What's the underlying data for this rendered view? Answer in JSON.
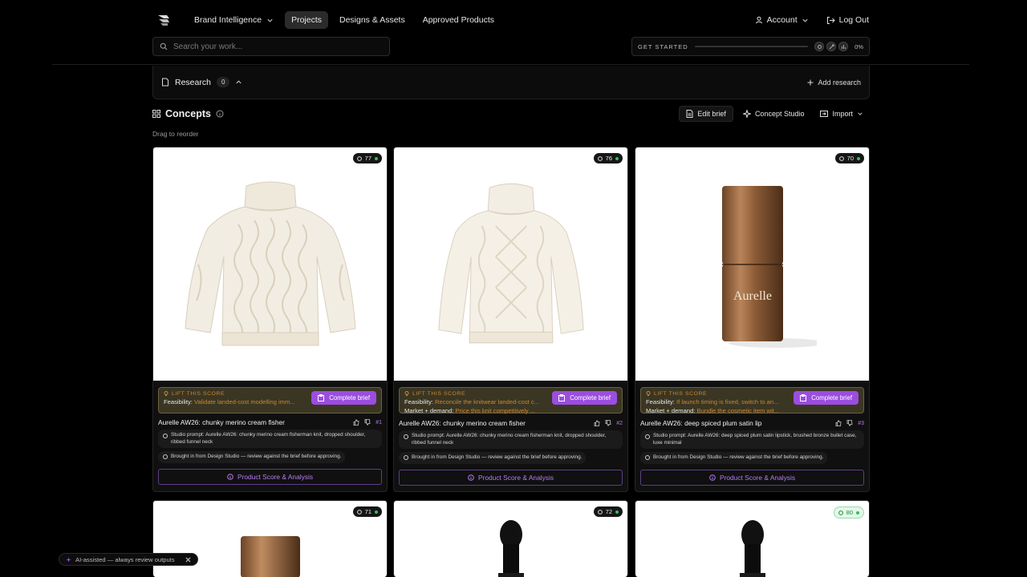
{
  "nav": {
    "items": [
      {
        "label": "Brand Intelligence",
        "has_dropdown": true,
        "active": false
      },
      {
        "label": "Projects",
        "has_dropdown": false,
        "active": true
      },
      {
        "label": "Designs & Assets",
        "has_dropdown": false,
        "active": false
      },
      {
        "label": "Approved Products",
        "has_dropdown": false,
        "active": false
      }
    ],
    "account_label": "Account",
    "logout_label": "Log Out"
  },
  "search": {
    "placeholder": "Search your work..."
  },
  "get_started": {
    "label": "GET STARTED",
    "progress_percent": 0,
    "progress_text": "0%",
    "step_icons": [
      "tag-icon",
      "link-icon",
      "chart-icon"
    ]
  },
  "research": {
    "title": "Research",
    "count": "0",
    "add_label": "Add research"
  },
  "concepts": {
    "title": "Concepts",
    "actions": {
      "edit_brief": "Edit brief",
      "concept_studio": "Concept Studio",
      "import": "Import"
    },
    "drag_hint": "Drag to reorder",
    "cards": [
      {
        "score": "77",
        "image_icon": "cable-knit-sweater-image",
        "lift_label": "LIFT THIS SCORE",
        "lift_lines": [
          {
            "key": "Feasibility:",
            "value": "Validate landed-cost modelling imm..."
          }
        ],
        "complete_label": "Complete brief",
        "title": "Aurelle AW26: chunky merino cream fisher",
        "rank": "#1",
        "prompt": "Studio prompt: Aurelle AW26: chunky merino cream fisherman knit, dropped shoulder, ribbed funnel neck",
        "provenance": "Brought in from Design Studio — review against the brief before approving.",
        "score_button": "Product Score & Analysis"
      },
      {
        "score": "76",
        "image_icon": "cable-knit-sweater-image",
        "lift_label": "LIFT THIS SCORE",
        "lift_lines": [
          {
            "key": "Feasibility:",
            "value": "Reconcile the knitwear landed-cost c..."
          },
          {
            "key": "Market + demand:",
            "value": "Price this knit competitively ..."
          }
        ],
        "complete_label": "Complete brief",
        "title": "Aurelle AW26: chunky merino cream fisher",
        "rank": "#2",
        "prompt": "Studio prompt: Aurelle AW26: chunky merino cream fisherman knit, dropped shoulder, ribbed funnel neck",
        "provenance": "Brought in from Design Studio — review against the brief before approving.",
        "score_button": "Product Score & Analysis"
      },
      {
        "score": "70",
        "image_icon": "lipstick-tube-image",
        "brand_text": "Aurelle",
        "lift_label": "LIFT THIS SCORE",
        "lift_lines": [
          {
            "key": "Feasibility:",
            "value": "If launch timing is fixed, switch to an..."
          },
          {
            "key": "Market + demand:",
            "value": "Bundle the cosmetic item wit..."
          }
        ],
        "complete_label": "Complete brief",
        "title": "Aurelle AW26: deep spiced plum satin lip",
        "rank": "#3",
        "prompt": "Studio prompt: Aurelle AW26: deep spiced plum satin lipstick, brushed bronze bullet case, luxe minimal",
        "provenance": "Brought in from Design Studio — review against the brief before approving.",
        "score_button": "Product Score & Analysis"
      }
    ],
    "row2_scores": [
      "71",
      "72",
      "80"
    ]
  },
  "toast": {
    "text": "AI-assisted — always review outputs"
  },
  "colors": {
    "accent_purple": "#9b4de0",
    "lift_orange": "#c9872f",
    "score_green": "#2fc15a"
  }
}
